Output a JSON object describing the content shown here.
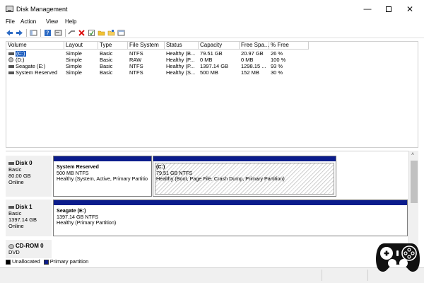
{
  "window": {
    "title": "Disk Management"
  },
  "menu": [
    "File",
    "Action",
    "View",
    "Help"
  ],
  "toolbar": [
    "back-icon",
    "forward-icon",
    "panel-icon",
    "help-icon",
    "properties-icon",
    "connect-icon",
    "delete-icon",
    "check-icon",
    "folder-icon",
    "open-icon",
    "console-icon"
  ],
  "volumes": {
    "columns": [
      "Volume",
      "Layout",
      "Type",
      "File System",
      "Status",
      "Capacity",
      "Free Spa...",
      "% Free"
    ],
    "rows": [
      {
        "volume": "(C:)",
        "layout": "Simple",
        "type": "Basic",
        "fs": "NTFS",
        "status": "Healthy (B...",
        "capacity": "79.51 GB",
        "free": "20.97 GB",
        "pct": "26 %"
      },
      {
        "volume": "(D:)",
        "layout": "Simple",
        "type": "Basic",
        "fs": "RAW",
        "status": "Healthy (P...",
        "capacity": "0 MB",
        "free": "0 MB",
        "pct": "100 %"
      },
      {
        "volume": "Seagate (E:)",
        "layout": "Simple",
        "type": "Basic",
        "fs": "NTFS",
        "status": "Healthy (P...",
        "capacity": "1397.14 GB",
        "free": "1298.15 ...",
        "pct": "93 %"
      },
      {
        "volume": "System Reserved",
        "layout": "Simple",
        "type": "Basic",
        "fs": "NTFS",
        "status": "Healthy (S...",
        "capacity": "500 MB",
        "free": "152 MB",
        "pct": "30 %"
      }
    ]
  },
  "disks": [
    {
      "name": "Disk 0",
      "type": "Basic",
      "size": "80.00 GB",
      "state": "Online",
      "partitions": [
        {
          "name": "System Reserved",
          "size": "500 MB NTFS",
          "status": "Healthy (System, Active, Primary Partitio"
        },
        {
          "name": "(C:)",
          "size": "79.51 GB NTFS",
          "status": "Healthy (Boot, Page File, Crash Dump, Primary Partition)"
        }
      ]
    },
    {
      "name": "Disk 1",
      "type": "Basic",
      "size": "1397.14 GB",
      "state": "Online",
      "partitions": [
        {
          "name": "Seagate  (E:)",
          "size": "1397.14 GB NTFS",
          "status": "Healthy (Primary Partition)"
        }
      ]
    },
    {
      "name": "CD-ROM 0",
      "type": "DVD"
    }
  ],
  "legend": [
    {
      "label": "Unallocated",
      "color": "#000000"
    },
    {
      "label": "Primary partition",
      "color": "#0b1c8c"
    }
  ],
  "colors": {
    "primary_bar": "#0b1c8c",
    "selection": "#1f5fbf"
  }
}
